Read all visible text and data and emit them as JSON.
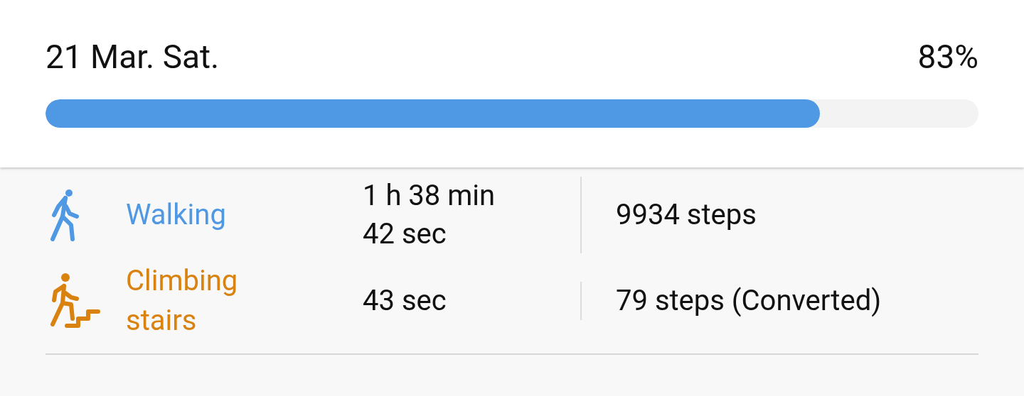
{
  "summary": {
    "date": "21 Mar. Sat.",
    "percent": "83%",
    "level": 0.83
  },
  "activities": [
    {
      "kind": "walking",
      "name": "Walking",
      "color": "#4f98e3",
      "duration": [
        "1 h 38 min",
        "42 sec"
      ],
      "steps": "9934 steps"
    },
    {
      "kind": "stairs",
      "name": "Climbing stairs",
      "color": "#d9820f",
      "duration": [
        "43 sec"
      ],
      "steps": "79 steps (Converted)"
    }
  ]
}
